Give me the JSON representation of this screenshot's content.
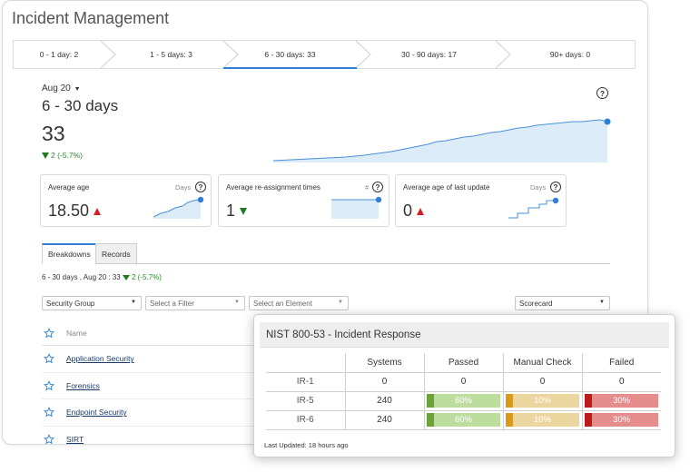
{
  "app": {
    "title": "Incident Management"
  },
  "buckets": [
    {
      "label": "0 - 1 day: 2",
      "active": false
    },
    {
      "label": "1 - 5 days: 3",
      "active": false
    },
    {
      "label": "6 - 30 days: 33",
      "active": true
    },
    {
      "label": "30 - 90 days: 17",
      "active": false
    },
    {
      "label": "90+ days: 0",
      "active": false
    }
  ],
  "summary": {
    "date": "Aug 20",
    "range_title": "6 - 30 days",
    "count": "33",
    "delta": "2 (-5.7%)",
    "delta_direction": "down"
  },
  "kpis": [
    {
      "label": "Average age",
      "unit": "Days",
      "value": "18.50",
      "trend": "up"
    },
    {
      "label": "Average re-assignment times",
      "unit": "#",
      "value": "1",
      "trend": "down"
    },
    {
      "label": "Average age of last update",
      "unit": "Days",
      "value": "0",
      "trend": "up"
    }
  ],
  "tabs": [
    {
      "label": "Breakdowns",
      "active": true
    },
    {
      "label": "Records",
      "active": false
    }
  ],
  "breadcrumb": {
    "text": "6 - 30 days , Aug 20 : 33",
    "delta": "2 (-5.7%)"
  },
  "filters": {
    "group": "Security Group",
    "filter_placeholder": "Select a Filter",
    "element_placeholder": "Select an Element",
    "view": "Scorecard"
  },
  "list": {
    "header": "Name",
    "rows": [
      "Application Security",
      "Forensics",
      "Endpoint Security",
      "SIRT"
    ]
  },
  "scorecard": {
    "title": "NIST 800-53 - Incident Response",
    "columns": [
      "Systems",
      "Passed",
      "Manual Check",
      "Failed"
    ],
    "rows": [
      {
        "label": "IR-1",
        "systems": "0",
        "passed": "0",
        "manual": "0",
        "failed": "0"
      },
      {
        "label": "IR-5",
        "systems": "240",
        "passed": "60%",
        "manual": "10%",
        "failed": "30%"
      },
      {
        "label": "IR-6",
        "systems": "240",
        "passed": "60%",
        "manual": "10%",
        "failed": "30%"
      }
    ],
    "bar_fraction": {
      "passed": 0.6,
      "manual": 0.1,
      "failed": 0.3
    },
    "updated": "Last Updated: 18 hours ago"
  },
  "colors": {
    "accent": "#2f7fd6",
    "passed": "#6aa33a",
    "manual": "#d89a18",
    "failed": "#c01b1b",
    "trend_fill": "#dcebf8",
    "trend_line": "#4a90d9"
  }
}
